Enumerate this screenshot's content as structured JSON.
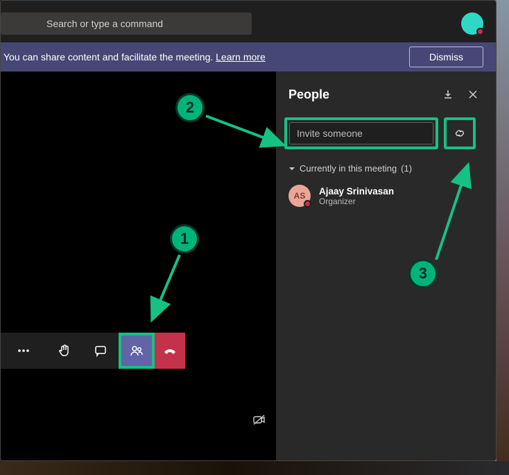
{
  "search": {
    "placeholder": "Search or type a command"
  },
  "notice": {
    "text": "You can share content and facilitate the meeting. ",
    "link_text": "Learn more",
    "dismiss_label": "Dismiss"
  },
  "people_panel": {
    "title": "People",
    "invite_placeholder": "Invite someone",
    "section_label": "Currently in this meeting",
    "section_count": "(1)",
    "participants": [
      {
        "initials": "AS",
        "name": "Ajaay Srinivasan",
        "role": "Organizer"
      }
    ]
  },
  "annotations": {
    "one": "1",
    "two": "2",
    "three": "3"
  },
  "accent_color": "#16c184"
}
